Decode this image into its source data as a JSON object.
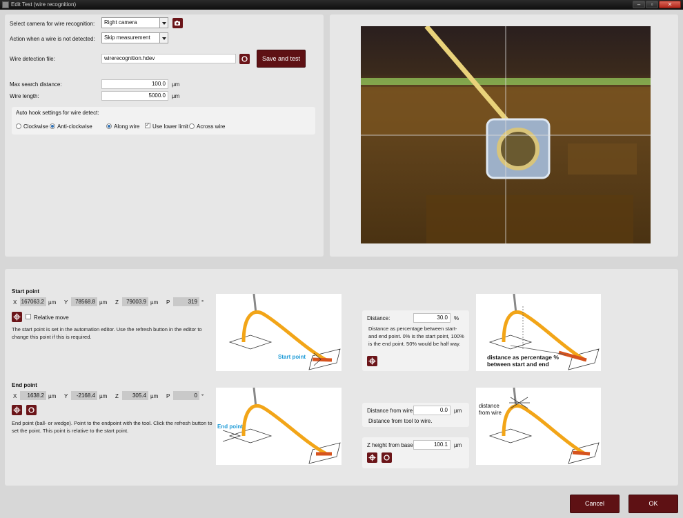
{
  "window": {
    "title": "Edit Test (wire recognition)",
    "min_glyph": "–",
    "max_glyph": "▫",
    "close_glyph": "✕"
  },
  "settings": {
    "camera_label": "Select camera for wire recognition:",
    "camera_value": "Right camera",
    "action_label": "Action when a wire is not detected:",
    "action_value": "Skip measurement",
    "file_label": "Wire detection file:",
    "file_value": "wirerecognition.hdev",
    "save_test_label": "Save and test",
    "max_search_label": "Max search distance:",
    "max_search_value": "100.0",
    "max_search_unit": "µm",
    "wire_length_label": "Wire length:",
    "wire_length_value": "5000.0",
    "wire_length_unit": "µm"
  },
  "autohook": {
    "title": "Auto hook settings for wire detect:",
    "clockwise": "Clockwise",
    "anticlockwise": "Anti-clockwise",
    "along_wire": "Along wire",
    "use_lower_limit": "Use lower limit",
    "across_wire": "Across wire",
    "clockwise_selected": false,
    "anticlockwise_selected": true,
    "along_selected": true,
    "lower_limit_checked": true,
    "across_selected": false
  },
  "start_point": {
    "title": "Start point",
    "x_label": "X",
    "x_value": "167063.2",
    "x_unit": "µm",
    "y_label": "Y",
    "y_value": "78568.8",
    "y_unit": "µm",
    "z_label": "Z",
    "z_value": "79003.9",
    "z_unit": "µm",
    "p_label": "P",
    "p_value": "319",
    "p_unit": "°",
    "relative_move": "Relative move",
    "description": "The start point is set in the automation editor. Use the refresh button in the editor to change this point if this is required.",
    "diagram_caption": "Start point"
  },
  "end_point": {
    "title": "End point",
    "x_label": "X",
    "x_value": "1638.2",
    "x_unit": "µm",
    "y_label": "Y",
    "y_value": "-2168.4",
    "y_unit": "µm",
    "z_label": "Z",
    "z_value": "305.4",
    "z_unit": "µm",
    "p_label": "P",
    "p_value": "0",
    "p_unit": "°",
    "description": "End point (ball- or wedge). Point to the endpoint with the tool. Click the refresh button to set the point. This point is relative to the start point.",
    "diagram_caption": "End point"
  },
  "distance": {
    "label": "Distance:",
    "value": "30.0",
    "unit": "%",
    "description": "Distance as percentage between start- and end point. 0% is the start point, 100% is the end point. 50% would be half way.",
    "diagram_caption_1": "distance as percentage %",
    "diagram_caption_2": "between start and end"
  },
  "distance_from_wire": {
    "label": "Distance from wire",
    "value": "0.0",
    "unit": "µm",
    "description": "Distance from tool to wire.",
    "diagram_caption_1": "distance",
    "diagram_caption_2": "from wire"
  },
  "z_height": {
    "label": "Z height from base",
    "value": "100.1",
    "unit": "µm"
  },
  "footer": {
    "cancel": "Cancel",
    "ok": "OK"
  },
  "colors": {
    "accent": "#5e1114",
    "wire_orange": "#f2a518",
    "caption_blue": "#1e9bd7"
  }
}
